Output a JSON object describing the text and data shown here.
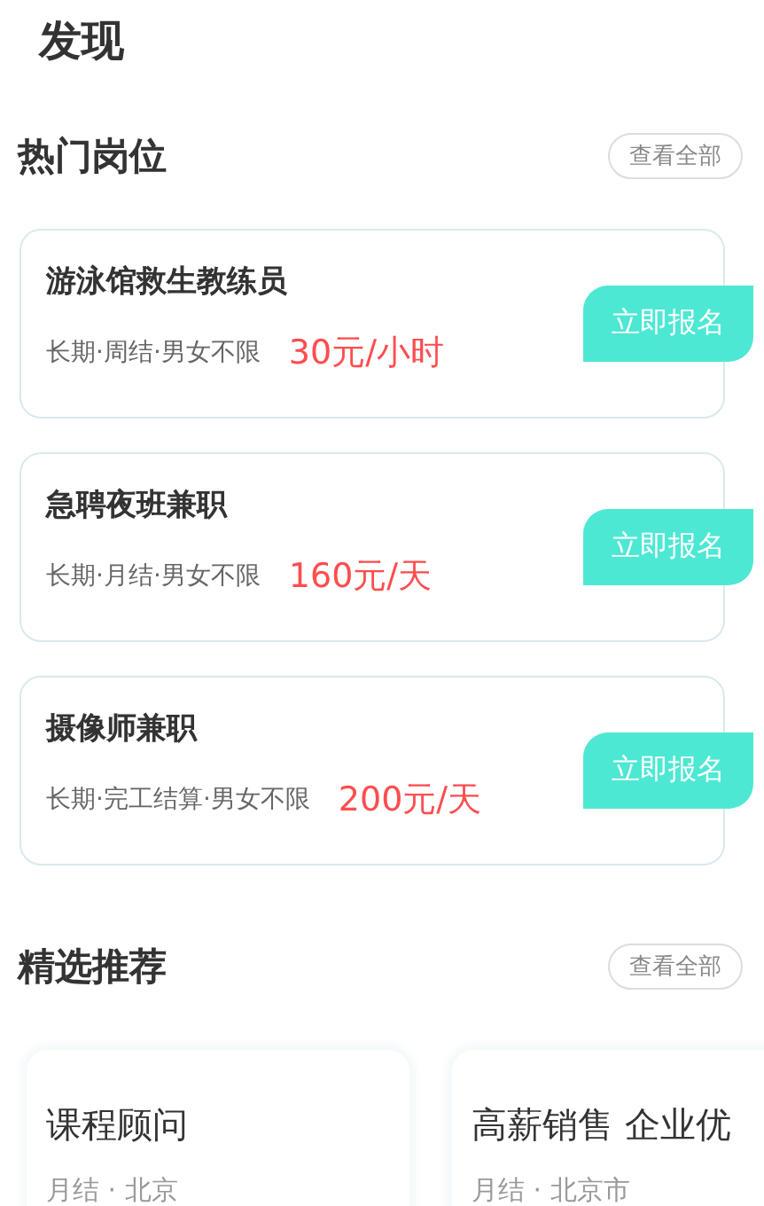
{
  "page_title": "发现",
  "hot_jobs": {
    "title": "热门岗位",
    "view_all": "查看全部",
    "jobs": [
      {
        "title": "游泳馆救生教练员",
        "tags": "长期·周结·男女不限",
        "pay": "30元/小时",
        "action": "立即报名"
      },
      {
        "title": "急聘夜班兼职",
        "tags": "长期·月结·男女不限",
        "pay": "160元/天",
        "action": "立即报名"
      },
      {
        "title": "摄像师兼职",
        "tags": "长期·完工结算·男女不限",
        "pay": "200元/天",
        "action": "立即报名"
      }
    ]
  },
  "featured": {
    "title": "精选推荐",
    "view_all": "查看全部",
    "items": [
      {
        "title": "课程顾问",
        "meta": "月结 · 北京"
      },
      {
        "title": "高薪销售 企业优",
        "meta": "月结 · 北京市"
      }
    ]
  }
}
